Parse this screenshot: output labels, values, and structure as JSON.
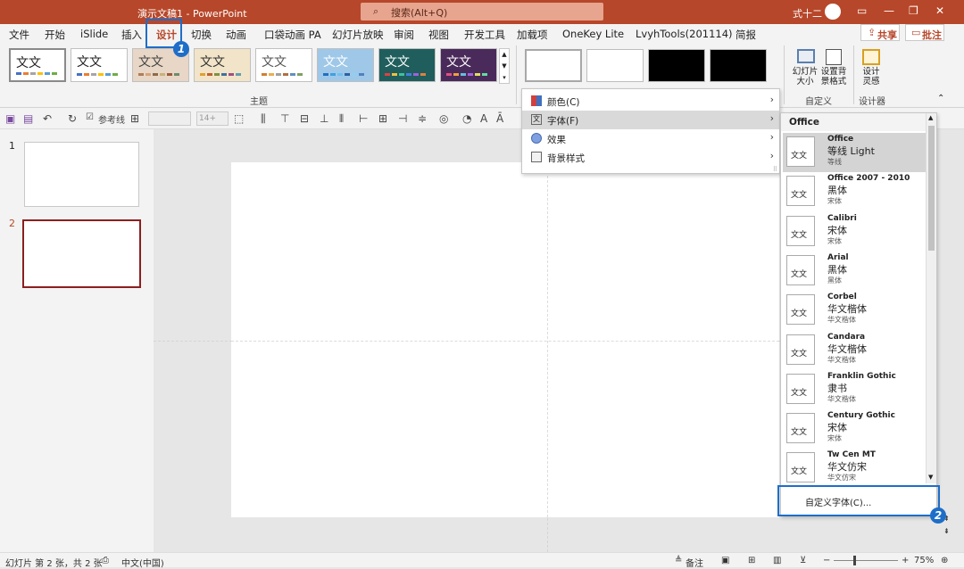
{
  "window": {
    "title": "演示文稿1  -  PowerPoint",
    "search_placeholder": "搜索(Alt+Q)",
    "user": "式十二"
  },
  "tabs": [
    "文件",
    "开始",
    "iSlide",
    "插入",
    "设计",
    "切换",
    "动画",
    "口袋动画 PA",
    "幻灯片放映",
    "审阅",
    "视图",
    "开发工具",
    "加载项",
    "OneKey Lite",
    "LvyhTools(201114)",
    "简报"
  ],
  "header_buttons": {
    "share": "共享",
    "comment": "批注"
  },
  "ribbon": {
    "theme_group_label": "主题",
    "theme_sample_text": "文文",
    "themes": [
      {
        "bg": "#ffffff",
        "fg": "#222222",
        "colors": [
          "#4472c4",
          "#ed7d31",
          "#a5a5a5",
          "#ffc000",
          "#5b9bd5",
          "#70ad47"
        ]
      },
      {
        "bg": "#ffffff",
        "fg": "#222222",
        "colors": [
          "#4472c4",
          "#ed7d31",
          "#a5a5a5",
          "#ffc000",
          "#5b9bd5",
          "#70ad47"
        ]
      },
      {
        "bg": "#e8d6c6",
        "fg": "#444444",
        "colors": [
          "#b07c5a",
          "#d6a47c",
          "#8c6a4a",
          "#c8b27a",
          "#9a5c3c",
          "#6c8c6c"
        ]
      },
      {
        "bg": "#f2e4c8",
        "fg": "#333333",
        "colors": [
          "#e0a030",
          "#c06030",
          "#809040",
          "#4070a0",
          "#a05080",
          "#60a0b0"
        ]
      },
      {
        "bg": "#ffffff",
        "fg": "#555555",
        "colors": [
          "#d08030",
          "#e8b050",
          "#a0a0a0",
          "#b07040",
          "#6090c0",
          "#80a060"
        ]
      },
      {
        "bg": "#9fc8e8",
        "fg": "#ffffff",
        "colors": [
          "#2070c0",
          "#40a0e0",
          "#70c0f0",
          "#3060a0",
          "#90d0f0",
          "#5080c0"
        ]
      },
      {
        "bg": "#1f5e5c",
        "fg": "#ffffff",
        "colors": [
          "#e04040",
          "#f0c040",
          "#40c0a0",
          "#4080e0",
          "#a060e0",
          "#e08040"
        ]
      },
      {
        "bg": "#4a2a5a",
        "fg": "#ffffff",
        "colors": [
          "#e05080",
          "#f0a040",
          "#60c0e0",
          "#a060e0",
          "#e0e060",
          "#60e0a0"
        ]
      }
    ],
    "customize_group_label": "自定义",
    "slide_size_label": "幻灯片\n大小",
    "format_bg_label": "设置背\n景格式",
    "designer_group_label": "设计器",
    "design_ideas_label": "设计\n灵感"
  },
  "qat": {
    "reference_line": "参考线"
  },
  "slides": [
    {
      "num": "1"
    },
    {
      "num": "2"
    }
  ],
  "variant_menu": {
    "items": [
      {
        "label": "颜色(C)",
        "icon": "color-palette-icon"
      },
      {
        "label": "字体(F)",
        "icon": "font-icon"
      },
      {
        "label": "效果",
        "icon": "effects-icon"
      },
      {
        "label": "背景样式",
        "icon": "background-style-icon"
      }
    ]
  },
  "font_panel": {
    "header": "Office",
    "sample": "文文",
    "fonts": [
      {
        "name": "Office",
        "heading": "等线 Light",
        "body": "等线"
      },
      {
        "name": "Office 2007 - 2010",
        "heading": "黑体",
        "body": "宋体"
      },
      {
        "name": "Calibri",
        "heading": "宋体",
        "body": "宋体"
      },
      {
        "name": "Arial",
        "heading": "黑体",
        "body": "黑体"
      },
      {
        "name": "Corbel",
        "heading": "华文楷体",
        "body": "华文楷体"
      },
      {
        "name": "Candara",
        "heading": "华文楷体",
        "body": "华文楷体"
      },
      {
        "name": "Franklin Gothic",
        "heading": "隶书",
        "body": "华文楷体"
      },
      {
        "name": "Century Gothic",
        "heading": "宋体",
        "body": "宋体"
      },
      {
        "name": "Tw Cen MT",
        "heading": "华文仿宋",
        "body": "华文仿宋"
      }
    ],
    "customize": "自定义字体(C)..."
  },
  "callouts": {
    "badge1": "1",
    "badge2": "2"
  },
  "status": {
    "slide_info": "幻灯片 第 2 张，共 2 张",
    "language": "中文(中国)",
    "notes": "备注",
    "zoom": "75%"
  }
}
